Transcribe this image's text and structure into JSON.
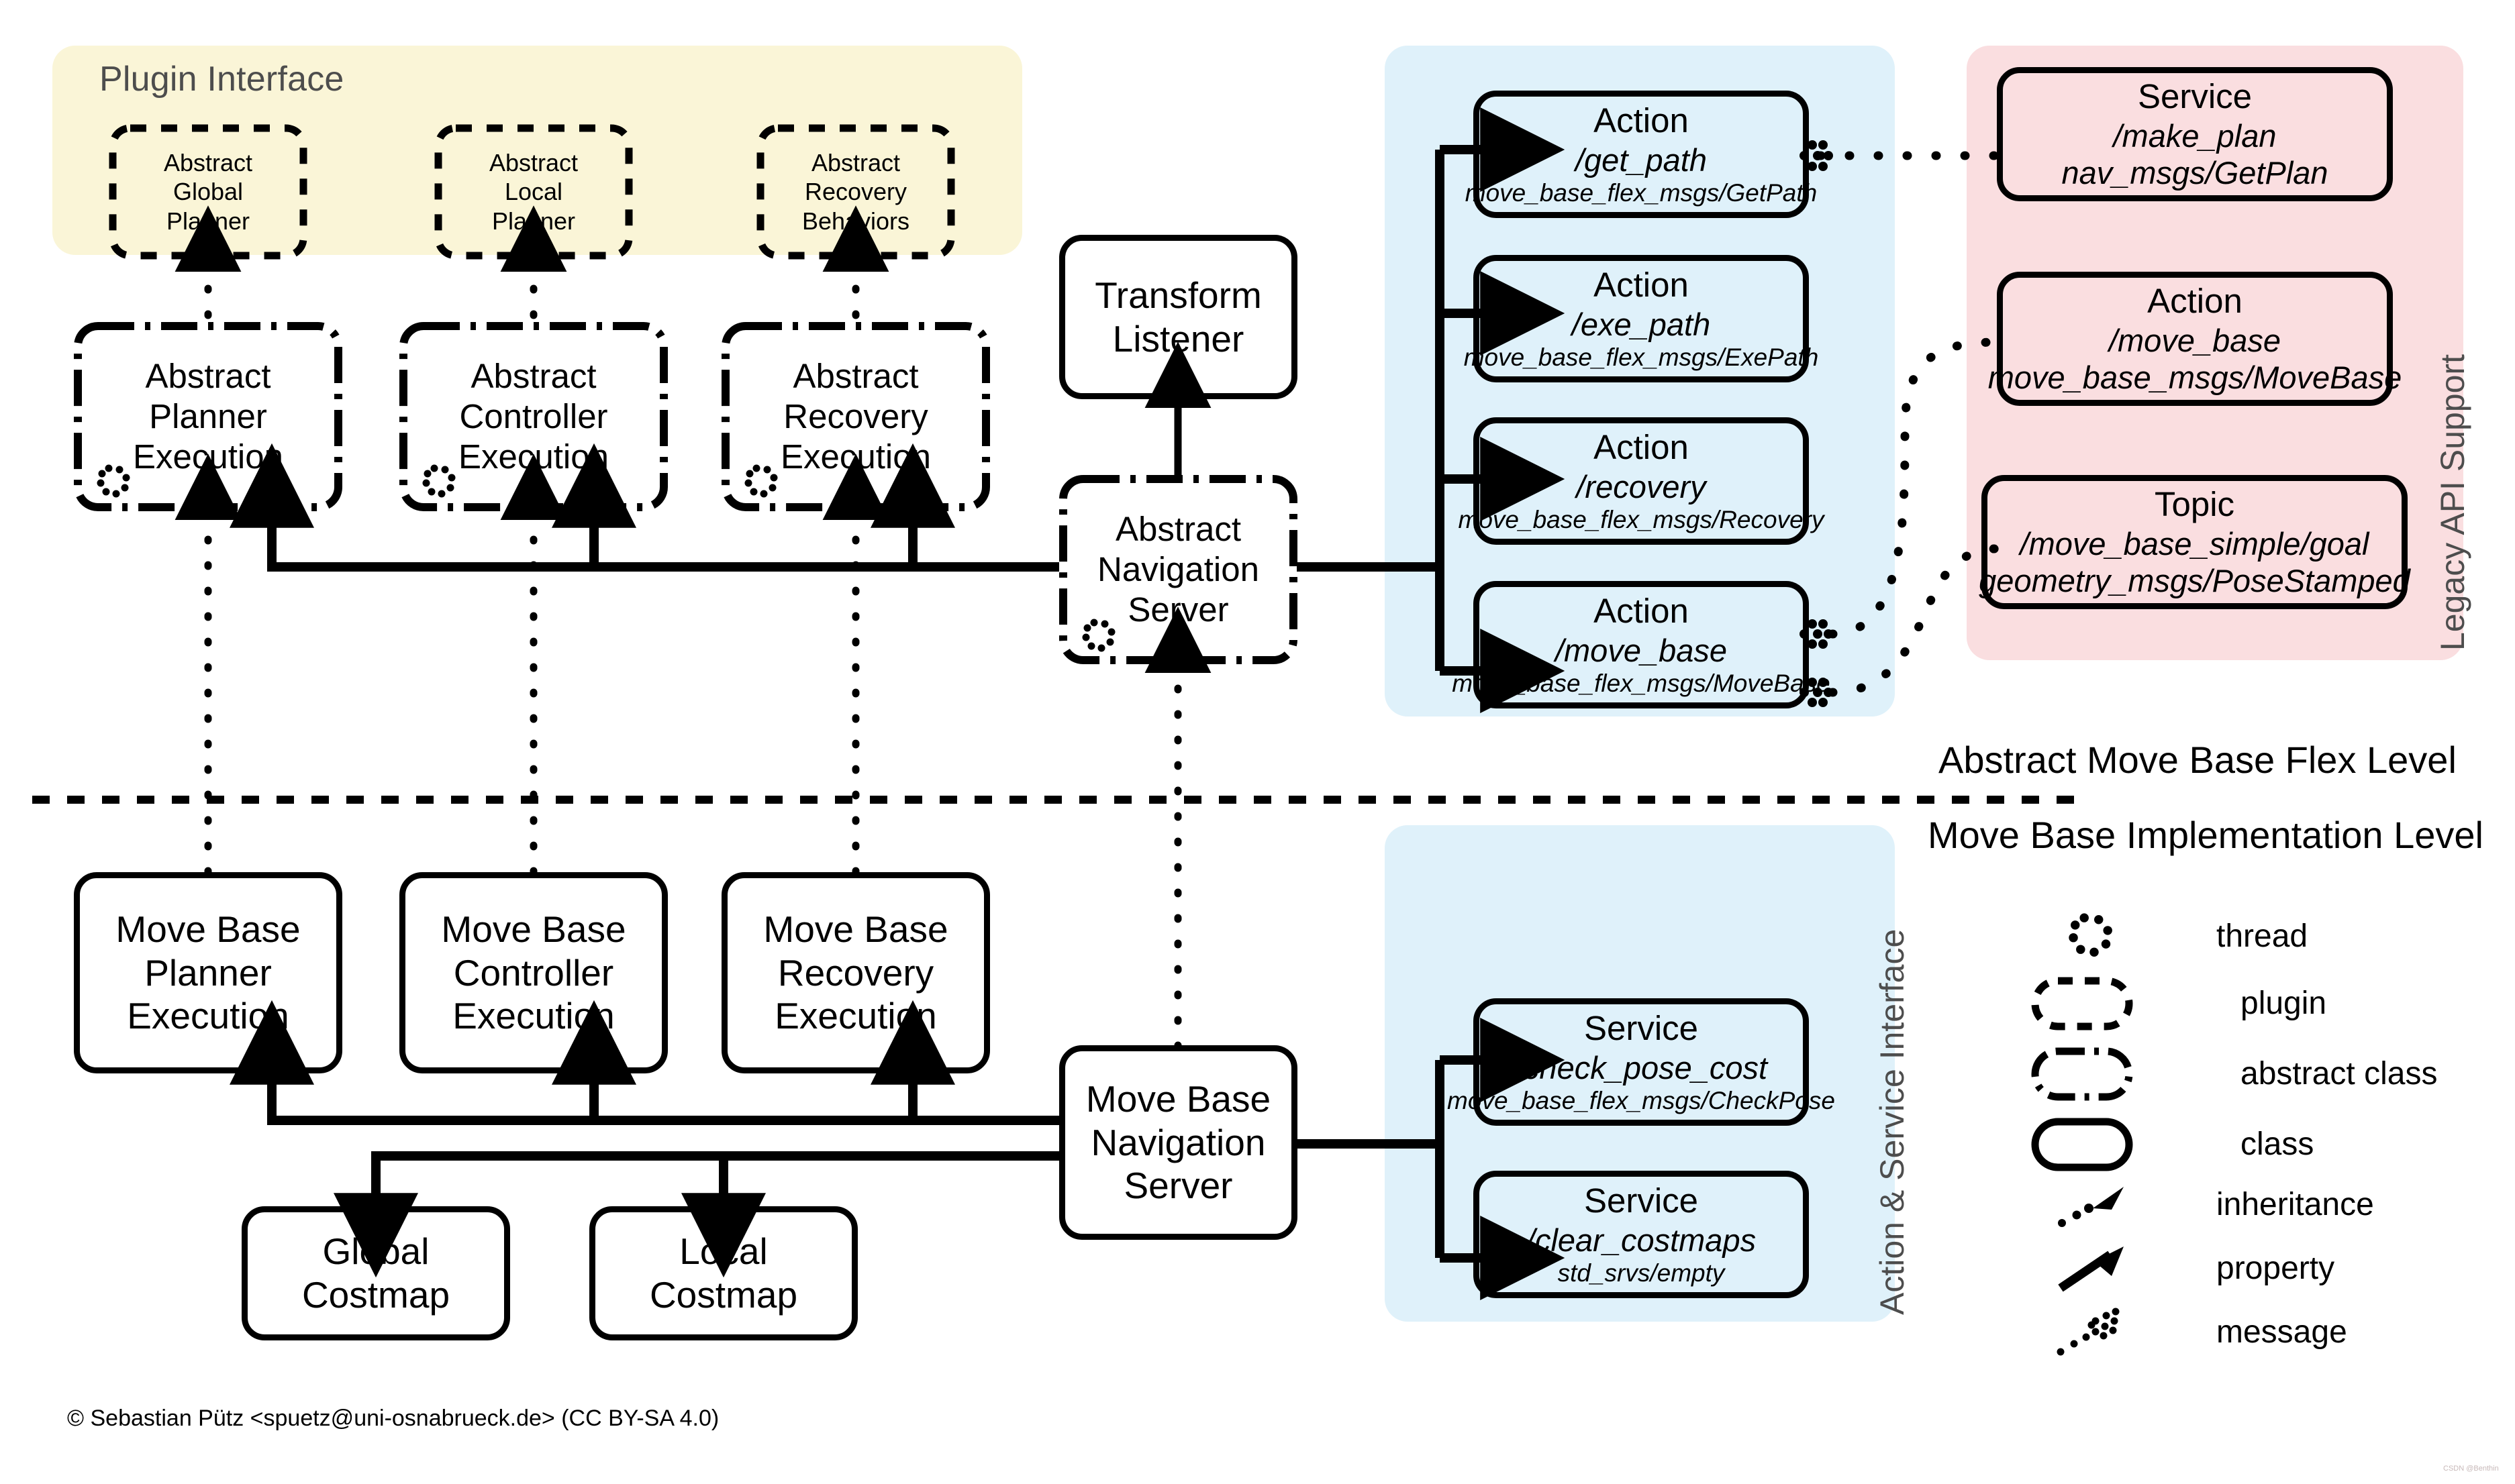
{
  "zones": {
    "plugin_interface": {
      "title": "Plugin Interface"
    },
    "action_service_interface": {
      "label": "Action & Service Interface"
    },
    "legacy_api_support": {
      "label": "Legacy API Support"
    }
  },
  "levels": {
    "abstract": "Abstract Move Base Flex Level",
    "implementation": "Move Base Implementation Level"
  },
  "plugins": [
    {
      "l1": "Abstract",
      "l2": "Global",
      "l3": "Planner"
    },
    {
      "l1": "Abstract",
      "l2": "Local",
      "l3": "Planner"
    },
    {
      "l1": "Abstract",
      "l2": "Recovery",
      "l3": "Behaviors"
    }
  ],
  "abstract_executions": [
    {
      "l1": "Abstract",
      "l2": "Planner",
      "l3": "Execution"
    },
    {
      "l1": "Abstract",
      "l2": "Controller",
      "l3": "Execution"
    },
    {
      "l1": "Abstract",
      "l2": "Recovery",
      "l3": "Execution"
    }
  ],
  "transform_listener": {
    "l1": "Transform",
    "l2": "Listener"
  },
  "abstract_navigation_server": {
    "l1": "Abstract",
    "l2": "Navigation",
    "l3": "Server"
  },
  "move_base_navigation_server": {
    "l1": "Move Base",
    "l2": "Navigation",
    "l3": "Server"
  },
  "move_base_executions": [
    {
      "l1": "Move Base",
      "l2": "Planner",
      "l3": "Execution"
    },
    {
      "l1": "Move Base",
      "l2": "Controller",
      "l3": "Execution"
    },
    {
      "l1": "Move Base",
      "l2": "Recovery",
      "l3": "Execution"
    }
  ],
  "costmaps": [
    {
      "l1": "Global",
      "l2": "Costmap"
    },
    {
      "l1": "Local",
      "l2": "Costmap"
    }
  ],
  "actions": [
    {
      "kind": "Action",
      "name": "/get_path",
      "type": "move_base_flex_msgs/GetPath"
    },
    {
      "kind": "Action",
      "name": "/exe_path",
      "type": "move_base_flex_msgs/ExePath"
    },
    {
      "kind": "Action",
      "name": "/recovery",
      "type": "move_base_flex_msgs/Recovery"
    },
    {
      "kind": "Action",
      "name": "/move_base",
      "type": "move_base_flex_msgs/MoveBase"
    }
  ],
  "services": [
    {
      "kind": "Service",
      "name": "/check_pose_cost",
      "type": "move_base_flex_msgs/CheckPose"
    },
    {
      "kind": "Service",
      "name": "/clear_costmaps",
      "type": "std_srvs/empty"
    }
  ],
  "legacy": [
    {
      "kind": "Service",
      "name": "/make_plan",
      "type": "nav_msgs/GetPlan"
    },
    {
      "kind": "Action",
      "name": "/move_base",
      "type": "move_base_msgs/MoveBase"
    },
    {
      "kind": "Topic",
      "name": "/move_base_simple/goal",
      "type": "geometry_msgs/PoseStamped"
    }
  ],
  "legend": [
    {
      "glyph": "thread-icon",
      "label": "thread"
    },
    {
      "glyph": "plugin-icon",
      "label": "plugin"
    },
    {
      "glyph": "abstract-class-icon",
      "label": "abstract class"
    },
    {
      "glyph": "class-icon",
      "label": "class"
    },
    {
      "glyph": "inheritance-arrow-icon",
      "label": "inheritance"
    },
    {
      "glyph": "property-arrow-icon",
      "label": "property"
    },
    {
      "glyph": "message-arrow-icon",
      "label": "message"
    }
  ],
  "footer": {
    "copyright": "© Sebastian Pütz <spuetz@uni-osnabrueck.de> (CC BY-SA 4.0)",
    "watermark": "CSDN @Benthin"
  },
  "colors": {
    "plugin_zone": "#faf5d7",
    "interface_zone": "#dff1fa",
    "legacy_zone": "#fadee0",
    "stroke": "#000000",
    "zone_label": "#4d4d4d"
  }
}
